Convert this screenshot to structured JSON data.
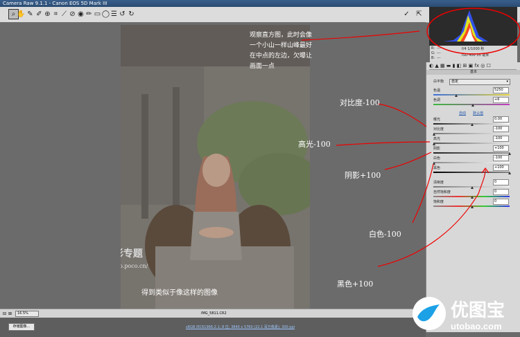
{
  "window": {
    "title": "Camera Raw 9.1.1 - Canon EOS 5D Mark III"
  },
  "toolbar": {
    "tools": [
      "zoom-icon",
      "hand-icon",
      "white-balance-icon",
      "color-sampler-icon",
      "target-adjust-icon",
      "crop-icon",
      "straighten-icon",
      "spot-removal-icon",
      "red-eye-icon",
      "adjustment-brush-icon",
      "graduated-filter-icon",
      "radial-filter-icon",
      "list-icon",
      "rotate-left-icon",
      "rotate-right-icon"
    ],
    "preview_label": "✓"
  },
  "histogram": {
    "readout": "f/4   1/1000 秒",
    "readout2": "ISO 400   35 毫米",
    "r": "R:",
    "g": "G:",
    "b": "B:",
    "dashes": "---"
  },
  "panel": {
    "section_title": "基本",
    "white_balance_label": "白平衡",
    "white_balance_value": "自定",
    "temperature": {
      "label": "色温",
      "value": "5250"
    },
    "tint": {
      "label": "色调",
      "value": "+6"
    },
    "auto_link": "自动",
    "default_link": "默认值",
    "sliders": [
      {
        "label": "曝光",
        "value": "0.00"
      },
      {
        "label": "对比度",
        "value": "-100"
      },
      {
        "label": "高光",
        "value": "-100"
      },
      {
        "label": "阴影",
        "value": "+100"
      },
      {
        "label": "白色",
        "value": "-100"
      },
      {
        "label": "黑色",
        "value": "+100"
      }
    ],
    "sliders2": [
      {
        "label": "清晰度",
        "value": "0"
      },
      {
        "label": "自然饱和度",
        "value": "0"
      },
      {
        "label": "饱和度",
        "value": "0"
      }
    ]
  },
  "status": {
    "zoom": "16.5%",
    "filename": "IMG_5811.CR2",
    "workflow": "sRGB IEC61966-2.1; 8 位; 3840 x 5760 (22.1 百万像素); 300 ppi",
    "save_button": "存储图像..."
  },
  "annotations": {
    "histogram_note": [
      "观察直方图，此时会像",
      "一个小山一样山峰最好",
      "在中点的左边，欠曝让",
      "画面一点"
    ],
    "contrast": "对比度-100",
    "highlights": "高光-100",
    "shadows": "阴影+100",
    "whites": "白色-100",
    "blacks": "黑色+100",
    "result": "得到类似于像这样的图像",
    "watermark_brand": "poco 摄影专题",
    "watermark_url": "http://photo.poco.cn/",
    "logo_cn": "优图宝",
    "logo_url": "utobao.com"
  }
}
